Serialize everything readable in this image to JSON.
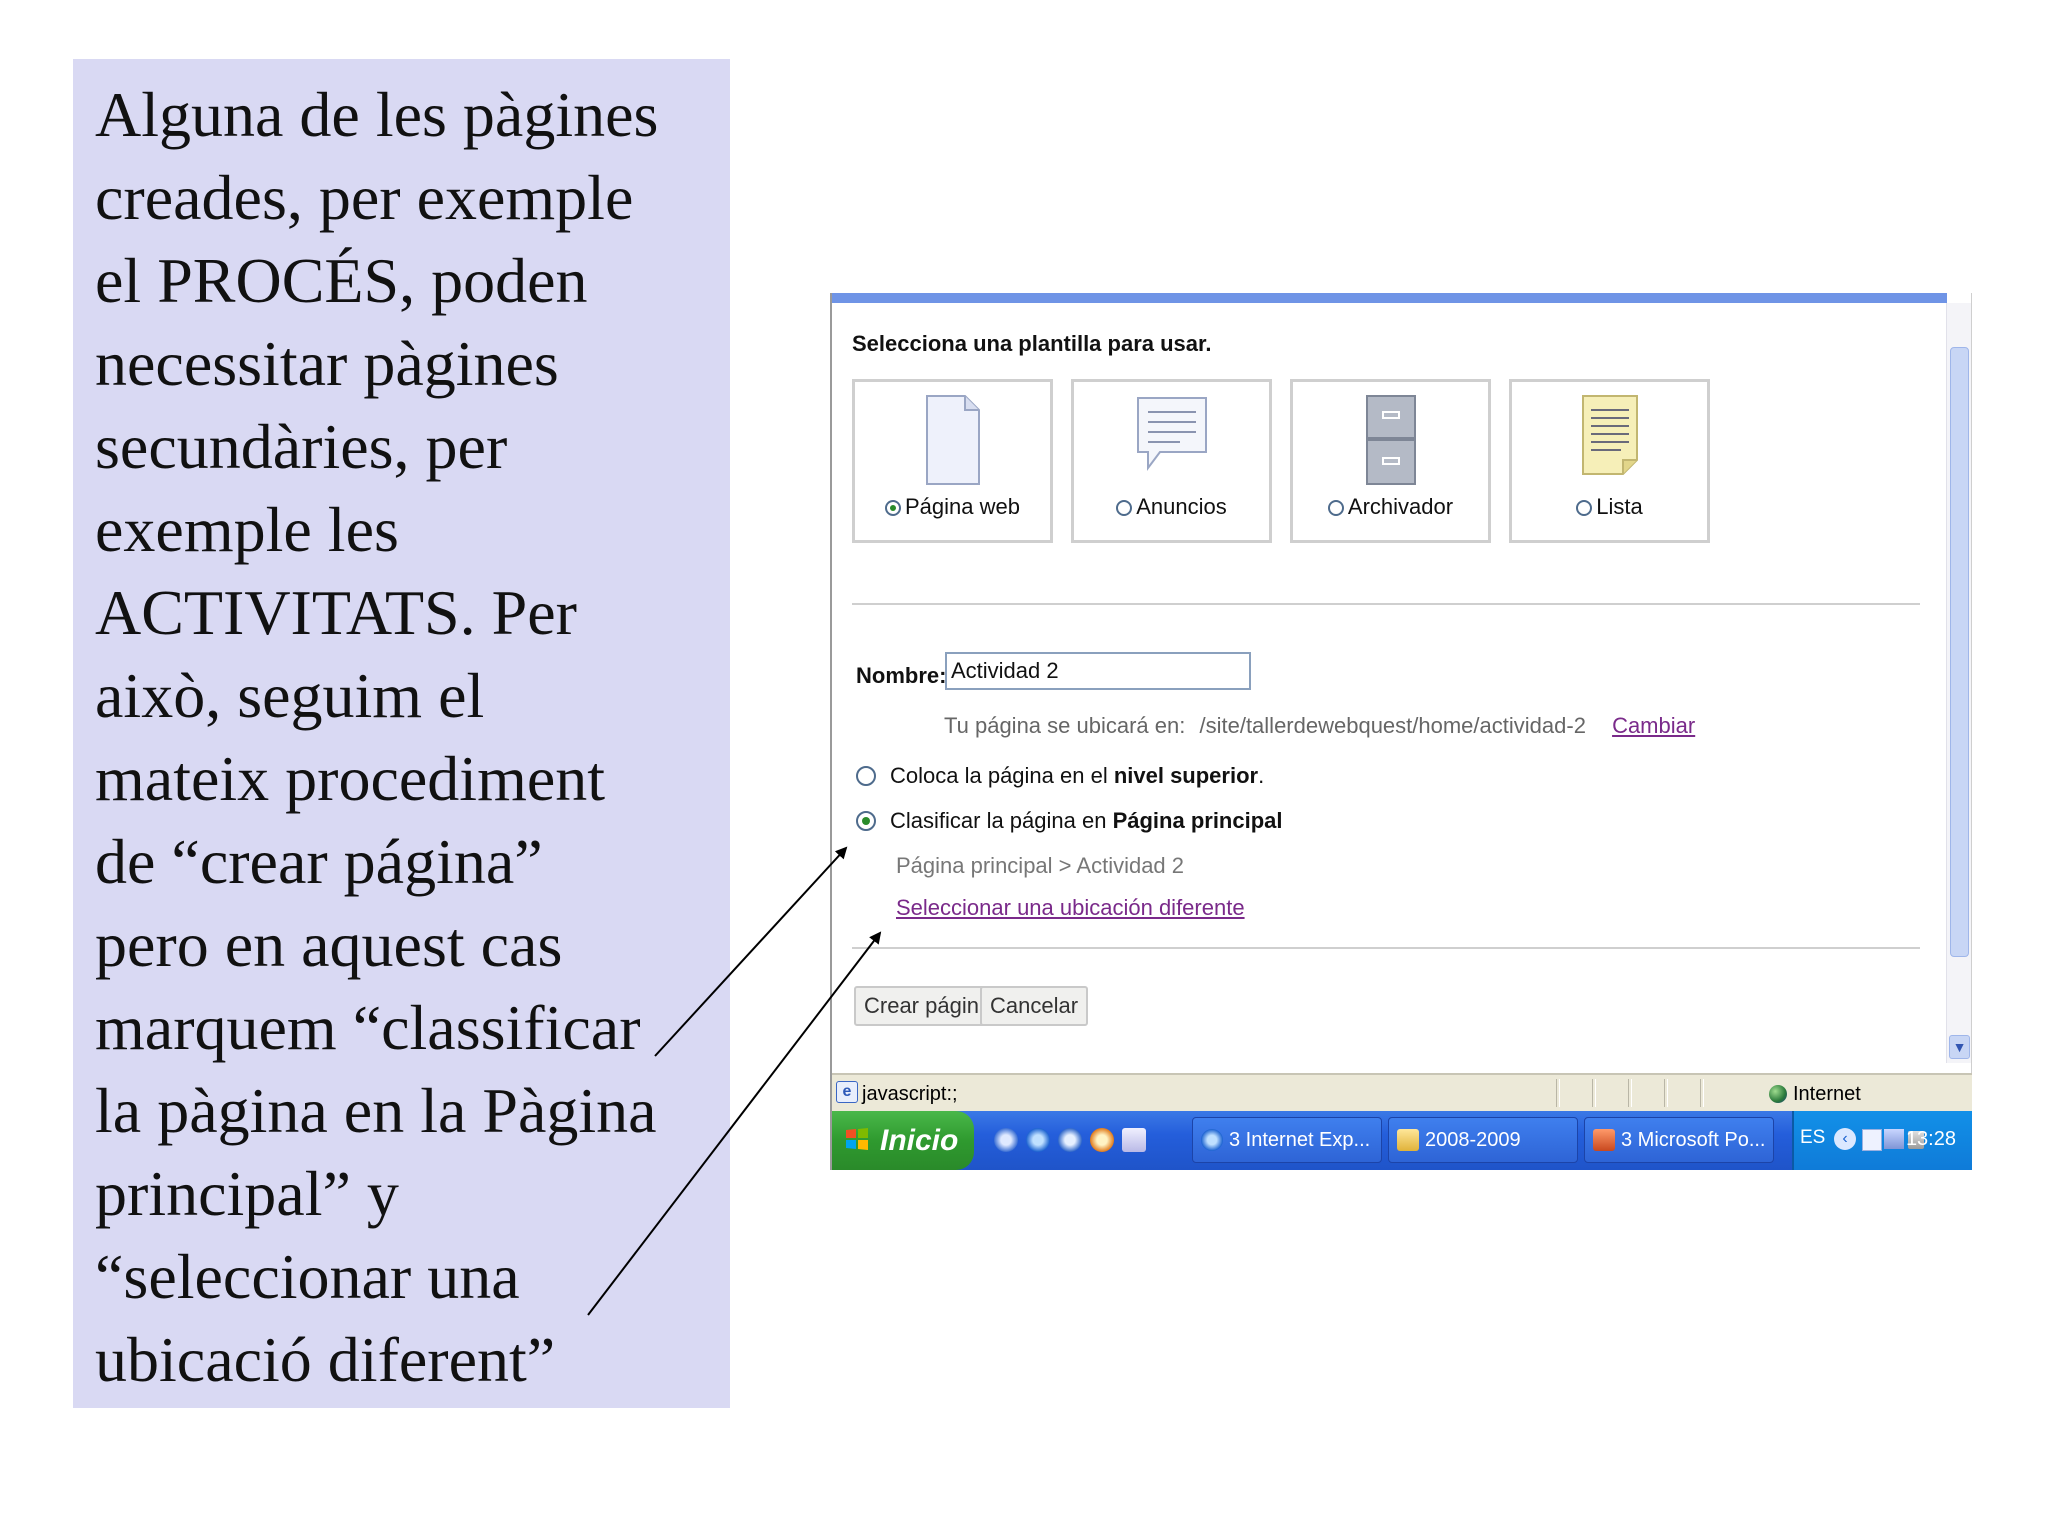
{
  "note": {
    "text": "Alguna de les pàgines\ncreades, per exemple\nel PROCÉS,  poden\nnecessitar pàgines\nsecundàries, per\nexemple les\nACTIVITATS. Per\naixò, seguim el\nmateix procediment\nde “crear página”\npero en aquest cas\nmarquem “classificar\nla pàgina en la Pàgina\nprincipal” y\n“seleccionar una\nubicació diferent”"
  },
  "form": {
    "pick_title": "Selecciona una plantilla para usar.",
    "templates": [
      {
        "label": "Página web",
        "icon": "document-icon",
        "selected": true
      },
      {
        "label": "Anuncios",
        "icon": "speech-bubble-icon",
        "selected": false
      },
      {
        "label": "Archivador",
        "icon": "file-cabinet-icon",
        "selected": false
      },
      {
        "label": "Lista",
        "icon": "list-note-icon",
        "selected": false
      }
    ],
    "name_label": "Nombre:",
    "name_value": "Actividad 2",
    "location_prefix": "Tu página se ubicará en:",
    "location_path": "/site/tallerdewebquest/home/actividad-2",
    "change_link": "Cambiar",
    "option_top_pre": "Coloca la página en el ",
    "option_top_bold": "nivel superior",
    "option_top_post": ".",
    "option_classify_pre": "Clasificar la página en ",
    "option_classify_bold": "Página principal",
    "breadcrumb": "Página principal > Actividad 2",
    "other_location_link": "Seleccionar una ubicación diferente",
    "create_button": "Crear página",
    "cancel_button": "Cancelar"
  },
  "statusbar": {
    "text": "javascript:;",
    "zone": "Internet"
  },
  "taskbar": {
    "start": "Inicio",
    "tasks": [
      "3 Internet Exp...",
      "2008-2009",
      "3 Microsoft Po..."
    ],
    "language": "ES",
    "clock": "13:28"
  },
  "colors": {
    "panel_bg": "#d9d9f3",
    "visited_link": "#7a2a8a",
    "taskbar_blue": "#245edb",
    "start_green": "#2f9a2f"
  }
}
